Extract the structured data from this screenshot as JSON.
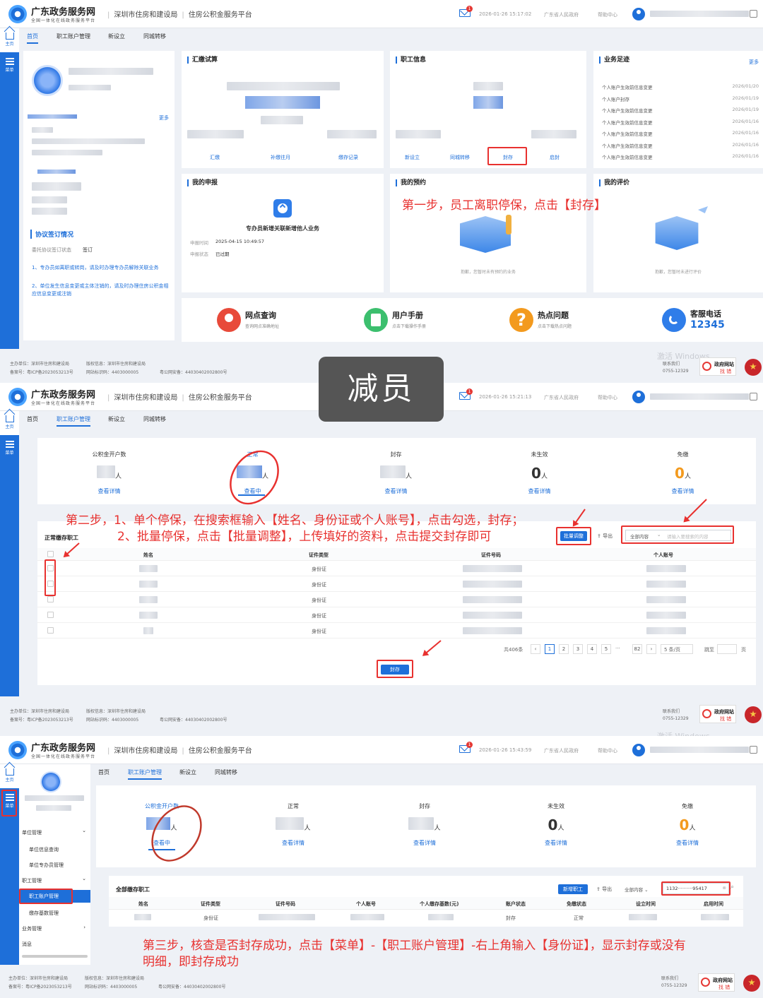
{
  "header": {
    "brand": "广东政务服务网",
    "brand_sub": "全国一体化在线政务服务平台",
    "title1": "深圳市住房和建设局",
    "title2": "住房公积金服务平台",
    "mail_badge": "1",
    "gov": "广东省人民政府",
    "help": "帮助中心"
  },
  "timestamps": [
    "2026-01-26 15:17:02",
    "2026-01-26 15:21:13",
    "2026-01-26 15:43:59"
  ],
  "side": {
    "home": "主页",
    "menu": "菜单"
  },
  "nav": {
    "home": "首页",
    "account": "职工账户管理",
    "setup": "新设立",
    "transfer": "同城转移"
  },
  "overlay_title": "减员",
  "screen1": {
    "cards": {
      "calc": "汇缴试算",
      "staff": "职工信息",
      "trace": "业务足迹",
      "more": "更多",
      "declare": "我的申报",
      "appoint": "我的预约",
      "review": "我的评价"
    },
    "calc_links": [
      "汇缴",
      "补缴往月",
      "缴存记录"
    ],
    "staff_links": [
      "新设立",
      "同城转移",
      "封存",
      "启封"
    ],
    "trace_items": [
      {
        "name": "个人账户生效前信息变更",
        "date": "2026/01/20"
      },
      {
        "name": "个人账户封存",
        "date": "2026/01/19"
      },
      {
        "name": "个人账户生效前信息变更",
        "date": "2026/01/19"
      },
      {
        "name": "个人账户生效前信息变更",
        "date": "2026/01/16"
      },
      {
        "name": "个人账户生效前信息变更",
        "date": "2026/01/16"
      },
      {
        "name": "个人账户生效前信息变更",
        "date": "2026/01/16"
      },
      {
        "name": "个人账户生效前信息变更",
        "date": "2026/01/16"
      }
    ],
    "left_more": "更多",
    "agreement_title": "协议签订情况",
    "agreement_label": "委托协议签订状态",
    "agreement_value": "签订",
    "notice1": "1、专办员如离职或转岗，请及时办理专办员解除关联业务",
    "notice2": "2、单位发生信息变更或主体注销的，请及时办理住房公积金相应信息变更或注销",
    "declare_task": "专办员新增关联新增他人业务",
    "declare_time_label": "申报时间",
    "declare_time": "2025-04-15 10:49:57",
    "declare_status_label": "申报状态",
    "declare_status": "已过期",
    "appoint_empty": "抱歉，您暂时未有预约的业务",
    "review_empty": "抱歉，您暂时未进行评价",
    "step1": "第一步，员工离职停保，点击【封存】",
    "quick": [
      {
        "title": "网点查询",
        "sub": "查询网点准确地址"
      },
      {
        "title": "用户手册",
        "sub": "点击下载操作手册"
      },
      {
        "title": "热点问题",
        "sub": "点击下载热点问题"
      },
      {
        "title": "客服电话",
        "sub": "12345"
      }
    ]
  },
  "footer": {
    "host": "主办单位：深圳市住房和建设局",
    "copyright": "版权信息：深圳市住房和建设局",
    "icp": "备案号：粤ICP备2023053213号",
    "site_code": "网站标识码：4403000005",
    "police": "粤公网安备：44030402002800号",
    "contact": "联系我们",
    "phone": "0755-12329",
    "find_err1": "政府网站",
    "find_err2": "找 错",
    "watermark": "激活 Windows"
  },
  "screen2": {
    "stats": [
      {
        "label": "公积金开户数",
        "num": "",
        "unit": "人",
        "link": "查看详情"
      },
      {
        "label": "正常",
        "num": "",
        "unit": "人",
        "link": "查看中"
      },
      {
        "label": "封存",
        "num": "",
        "unit": "人",
        "link": "查看详情"
      },
      {
        "label": "未生效",
        "num": "0",
        "unit": "人",
        "link": "查看详情"
      },
      {
        "label": "免缴",
        "num": "0",
        "unit": "人",
        "link": "查看详情"
      }
    ],
    "section_title": "正常缴存职工",
    "step2a": "第二步，1、单个停保，在搜索框输入【姓名、身份证或个人账号】，点击勾选，封存；",
    "step2b": "2、批量停保，点击【批量调整】，上传填好的资料，点击提交封存即可",
    "batch_btn": "批量调整",
    "export": "导出",
    "search_scope": "全部内容",
    "search_placeholder": "请输入要搜索的内容",
    "columns": [
      "姓名",
      "证件类型",
      "证件号码",
      "个人账号"
    ],
    "id_type": "身份证",
    "total": "共406条",
    "pages": [
      "1",
      "2",
      "3",
      "4",
      "5",
      "···",
      "82"
    ],
    "per_page": "5 条/页",
    "goto": "跳至",
    "page_unit": "页",
    "seal_btn": "封存"
  },
  "screen3": {
    "sidebar": {
      "unit_mgmt": "单位管理",
      "unit_info": "单位信息查询",
      "unit_agent": "单位专办员管理",
      "staff_mgmt": "职工管理",
      "staff_account": "职工账户管理",
      "deposit_base": "缴存基数管理",
      "business": "业务管理",
      "message": "消息"
    },
    "stats": [
      {
        "label": "公积金开户数",
        "num": "",
        "unit": "人",
        "link": "查看中"
      },
      {
        "label": "正常",
        "num": "",
        "unit": "人",
        "link": "查看详情"
      },
      {
        "label": "封存",
        "num": "",
        "unit": "人",
        "link": "查看详情"
      },
      {
        "label": "未生效",
        "num": "0",
        "unit": "人",
        "link": "查看详情"
      },
      {
        "label": "免缴",
        "num": "0",
        "unit": "人",
        "link": "查看详情"
      }
    ],
    "section_title": "全部缴存职工",
    "add_btn": "新增职工",
    "export": "导出",
    "search_scope": "全部内容",
    "search_value": "1132··········95417",
    "columns": [
      "姓名",
      "证件类型",
      "证件号码",
      "个人账号",
      "个人缴存基数(元)",
      "账户状态",
      "免缴状态",
      "设立时间",
      "启用时间"
    ],
    "row": {
      "id_type": "身份证",
      "status": "封存",
      "exempt": "正常"
    },
    "step3a": "第三步，核查是否封存成功，点击【菜单】-【职工账户管理】-右上角输入【身份证】，显示封存或没有",
    "step3b": "明细，即封存成功"
  }
}
